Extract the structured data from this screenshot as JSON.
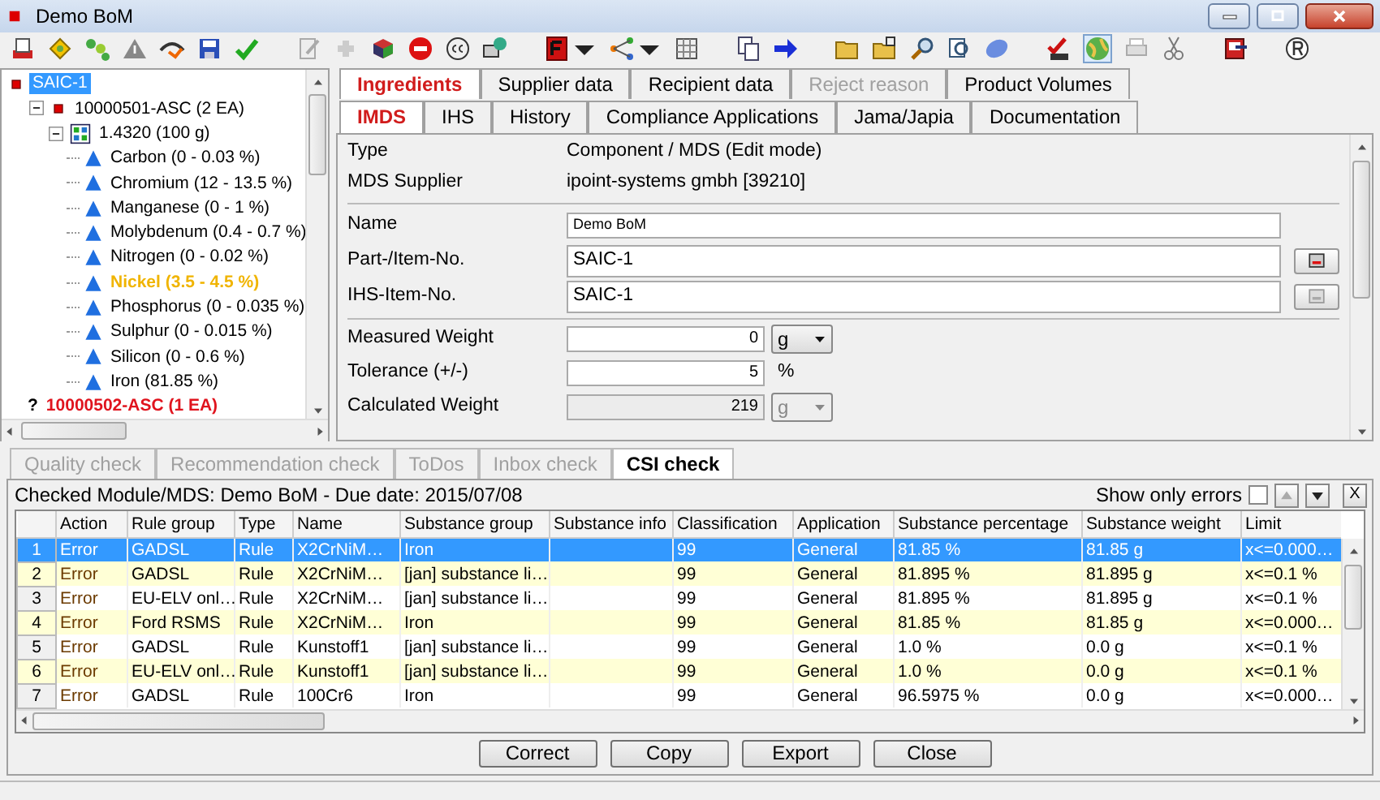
{
  "window": {
    "title": "Demo BoM"
  },
  "tree": [
    {
      "label": "SAIC-1",
      "kind": "module",
      "selected": true,
      "children": [
        {
          "label": "10000501-ASC (2 EA)",
          "kind": "module",
          "color": "#000000",
          "selected": false,
          "expanded": true,
          "children": [
            {
              "label": "1.4320 (100 g)",
              "kind": "material",
              "color": "#000000",
              "selected": false,
              "expanded": true,
              "children": [
                {
                  "label": "Carbon (0 - 0.03 %)",
                  "kind": "substance",
                  "color": "#000000",
                  "selected": false
                },
                {
                  "label": "Chromium (12 - 13.5 %)",
                  "kind": "substance",
                  "color": "#000000",
                  "selected": false
                },
                {
                  "label": "Manganese (0 - 1 %)",
                  "kind": "substance",
                  "color": "#000000",
                  "selected": false
                },
                {
                  "label": "Molybdenum (0.4 - 0.7 %)",
                  "kind": "substance",
                  "color": "#000000",
                  "selected": false
                },
                {
                  "label": "Nitrogen (0 - 0.02 %)",
                  "kind": "substance",
                  "color": "#000000",
                  "selected": false
                },
                {
                  "label": "Nickel (3.5 - 4.5 %)",
                  "kind": "substance",
                  "color": "#f0b400",
                  "selected": false
                },
                {
                  "label": "Phosphorus (0 - 0.035 %)",
                  "kind": "substance",
                  "color": "#000000",
                  "selected": false
                },
                {
                  "label": "Sulphur (0 - 0.015 %)",
                  "kind": "substance",
                  "color": "#000000",
                  "selected": false
                },
                {
                  "label": "Silicon (0 - 0.6 %)",
                  "kind": "substance",
                  "color": "#000000",
                  "selected": false
                },
                {
                  "label": "Iron (81.85 %)",
                  "kind": "substance",
                  "color": "#000000",
                  "selected": false
                }
              ]
            }
          ]
        },
        {
          "label": "10000502-ASC (1 EA)",
          "kind": "unknown",
          "symbol": "?",
          "color": "#e0141e",
          "selected": false
        }
      ]
    }
  ],
  "tabs": [
    {
      "label": "Ingredients",
      "selected": true,
      "disabled": false
    },
    {
      "label": "Supplier data",
      "selected": false,
      "disabled": false
    },
    {
      "label": "Recipient data",
      "selected": false,
      "disabled": false
    },
    {
      "label": "Reject reason",
      "selected": false,
      "disabled": true
    },
    {
      "label": "Product Volumes",
      "selected": false,
      "disabled": false
    }
  ],
  "subtabs": [
    {
      "label": "IMDS",
      "selected": true
    },
    {
      "label": "IHS",
      "selected": false
    },
    {
      "label": "History",
      "selected": false
    },
    {
      "label": "Compliance Applications",
      "selected": false
    },
    {
      "label": "Jama/Japia",
      "selected": false
    },
    {
      "label": "Documentation",
      "selected": false
    }
  ],
  "info": [
    {
      "label": "Type",
      "value": "Component / MDS (Edit mode)"
    },
    {
      "label": "MDS Supplier",
      "value": "ipoint-systems gmbh [39210]"
    }
  ],
  "fields": [
    {
      "label": "Name",
      "value": "Demo BoM",
      "kind": "small"
    },
    {
      "label": "Part-/Item-No.",
      "value": "SAIC-1",
      "kind": "lookup",
      "disabled": false
    },
    {
      "label": "IHS-Item-No.",
      "value": "SAIC-1",
      "kind": "lookup",
      "disabled": true
    }
  ],
  "weights": [
    {
      "label": "Measured Weight",
      "value": "0",
      "unit": "g",
      "kind": "select",
      "disabled": false
    },
    {
      "label": "Tolerance (+/-)",
      "value": "5",
      "unit": "%",
      "kind": "text",
      "disabled": false
    },
    {
      "label": "Calculated Weight",
      "value": "219",
      "unit": "g",
      "kind": "select",
      "disabled": true
    }
  ],
  "check_tabs": [
    {
      "label": "Quality check",
      "selected": false,
      "disabled": true
    },
    {
      "label": "Recommendation check",
      "selected": false,
      "disabled": true
    },
    {
      "label": "ToDos",
      "selected": false,
      "disabled": true
    },
    {
      "label": "Inbox check",
      "selected": false,
      "disabled": true
    },
    {
      "label": "CSI check",
      "selected": true,
      "disabled": false
    }
  ],
  "check_info": "Checked Module/MDS: Demo BoM - Due date: 2015/07/08",
  "show_only_errors": {
    "label": "Show only errors",
    "checked": false
  },
  "close_label": "X",
  "table": {
    "columns": [
      "Action",
      "Rule group",
      "Type",
      "Name",
      "Substance group",
      "Substance info",
      "Classification",
      "Application",
      "Substance percentage",
      "Substance weight",
      "Limit"
    ],
    "rows": [
      {
        "number": "1",
        "selected": true,
        "action": "Error",
        "rule_group": "GADSL",
        "type": "Rule",
        "name": "X2CrNiM…",
        "substance_group": "Iron",
        "classification": "99",
        "application": "General",
        "substance_percentage": "81.85 %",
        "substance_weight": "81.85 g",
        "limit": "x<=0.000…"
      },
      {
        "number": "2",
        "selected": false,
        "action": "Error",
        "rule_group": "GADSL",
        "type": "Rule",
        "name": "X2CrNiM…",
        "substance_group": "[jan] substance li…",
        "classification": "99",
        "application": "General",
        "substance_percentage": "81.895 %",
        "substance_weight": "81.895 g",
        "limit": "x<=0.1 %"
      },
      {
        "number": "3",
        "selected": false,
        "action": "Error",
        "rule_group": "EU-ELV onl…",
        "type": "Rule",
        "name": "X2CrNiM…",
        "substance_group": "[jan] substance li…",
        "classification": "99",
        "application": "General",
        "substance_percentage": "81.895 %",
        "substance_weight": "81.895 g",
        "limit": "x<=0.1 %"
      },
      {
        "number": "4",
        "selected": false,
        "action": "Error",
        "rule_group": "Ford RSMS",
        "type": "Rule",
        "name": "X2CrNiM…",
        "substance_group": "Iron",
        "classification": "99",
        "application": "General",
        "substance_percentage": "81.85 %",
        "substance_weight": "81.85 g",
        "limit": "x<=0.000…"
      },
      {
        "number": "5",
        "selected": false,
        "action": "Error",
        "rule_group": "GADSL",
        "type": "Rule",
        "name": "Kunstoff1",
        "substance_group": "[jan] substance li…",
        "classification": "99",
        "application": "General",
        "substance_percentage": "1.0 %",
        "substance_weight": "0.0 g",
        "limit": "x<=0.1 %"
      },
      {
        "number": "6",
        "selected": false,
        "action": "Error",
        "rule_group": "EU-ELV onl…",
        "type": "Rule",
        "name": "Kunstoff1",
        "substance_group": "[jan] substance li…",
        "classification": "99",
        "application": "General",
        "substance_percentage": "1.0 %",
        "substance_weight": "0.0 g",
        "limit": "x<=0.1 %"
      },
      {
        "number": "7",
        "selected": false,
        "action": "Error",
        "rule_group": "GADSL",
        "type": "Rule",
        "name": "100Cr6",
        "substance_group": "Iron",
        "classification": "99",
        "application": "General",
        "substance_percentage": "96.5975 %",
        "substance_weight": "0.0 g",
        "limit": "x<=0.000…"
      }
    ]
  },
  "buttons": [
    "Correct",
    "Copy",
    "Export",
    "Close"
  ]
}
